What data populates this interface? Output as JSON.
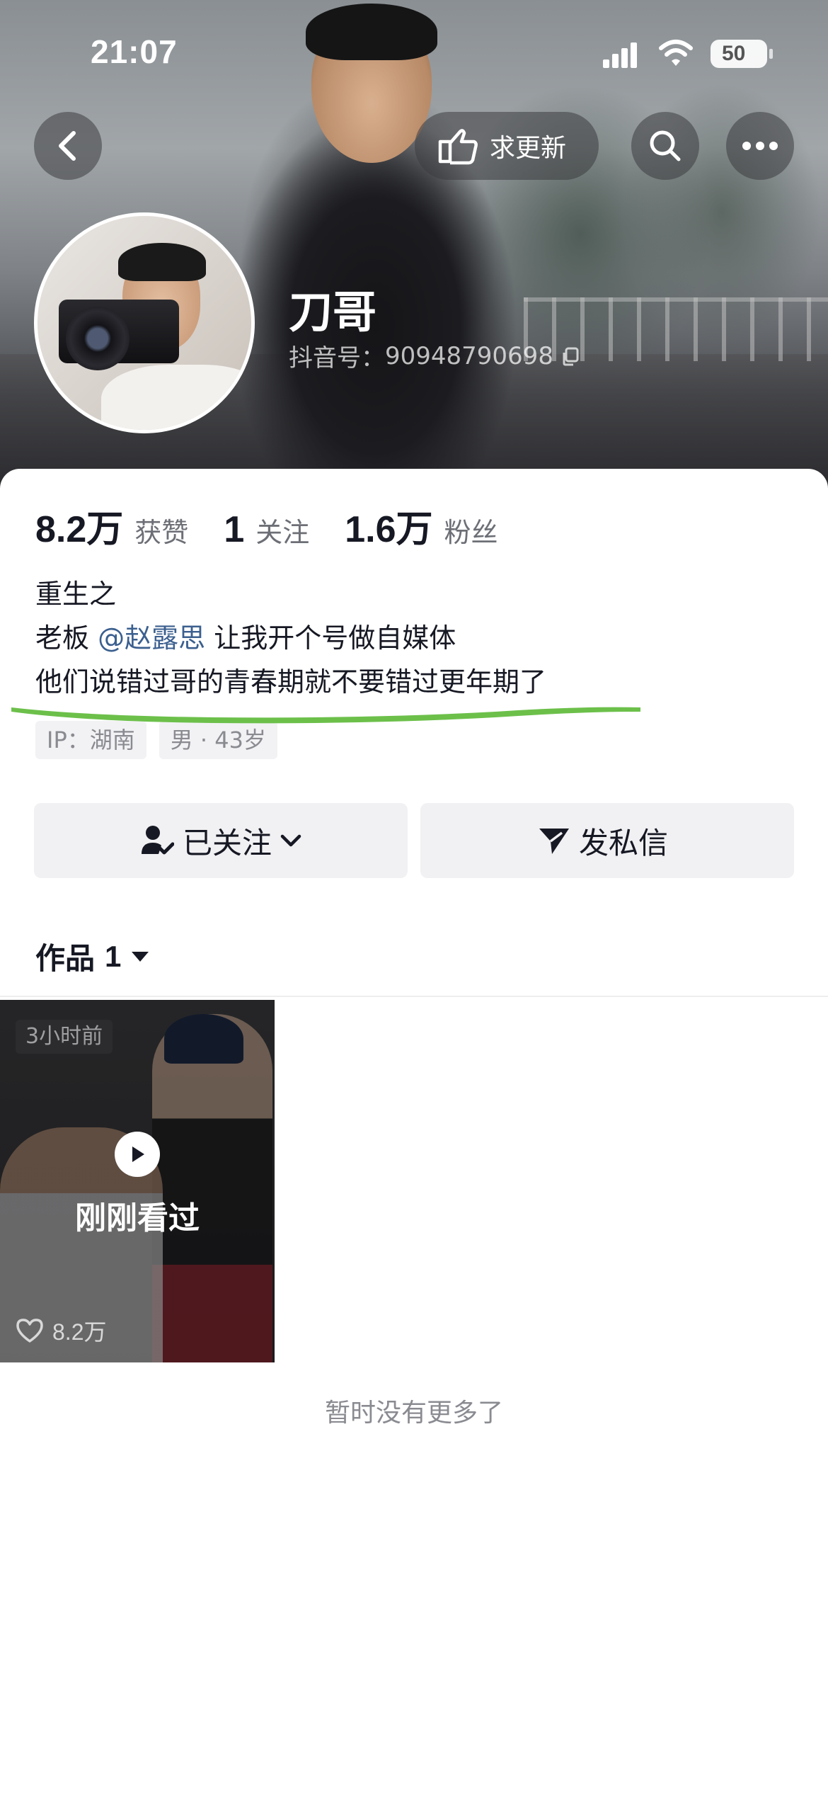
{
  "status_bar": {
    "time": "21:07",
    "battery": "50"
  },
  "header": {
    "request_update_label": "求更新",
    "icons": [
      "back-arrow-icon",
      "hand-pointing-icon",
      "search-icon",
      "more-icon"
    ]
  },
  "profile": {
    "name": "刀哥",
    "douyin_id_label": "抖音号：",
    "douyin_id": "90948790698"
  },
  "stats": [
    {
      "value": "8.2万",
      "label": "获赞"
    },
    {
      "value": "1",
      "label": "关注"
    },
    {
      "value": "1.6万",
      "label": "粉丝"
    }
  ],
  "bio": {
    "line1": "重生之",
    "line2_prefix": "老板 ",
    "line2_mention": "@赵露思",
    "line2_suffix": " 让我开个号做自媒体",
    "line3": "他们说错过哥的青春期就不要错过更年期了"
  },
  "tags": [
    "IP：湖南",
    "男 · 43岁"
  ],
  "actions": {
    "follow_label": "已关注",
    "message_label": "发私信"
  },
  "works_tab": {
    "label": "作品",
    "count": "1"
  },
  "videos": [
    {
      "time_badge": "3小时前",
      "overlay": "刚刚看过",
      "likes": "8.2万"
    }
  ],
  "footer": {
    "no_more": "暂时没有更多了"
  },
  "colors": {
    "mention": "#3b5f8f",
    "underline_annotation": "#6cc04a",
    "button_bg": "#f1f1f3"
  }
}
